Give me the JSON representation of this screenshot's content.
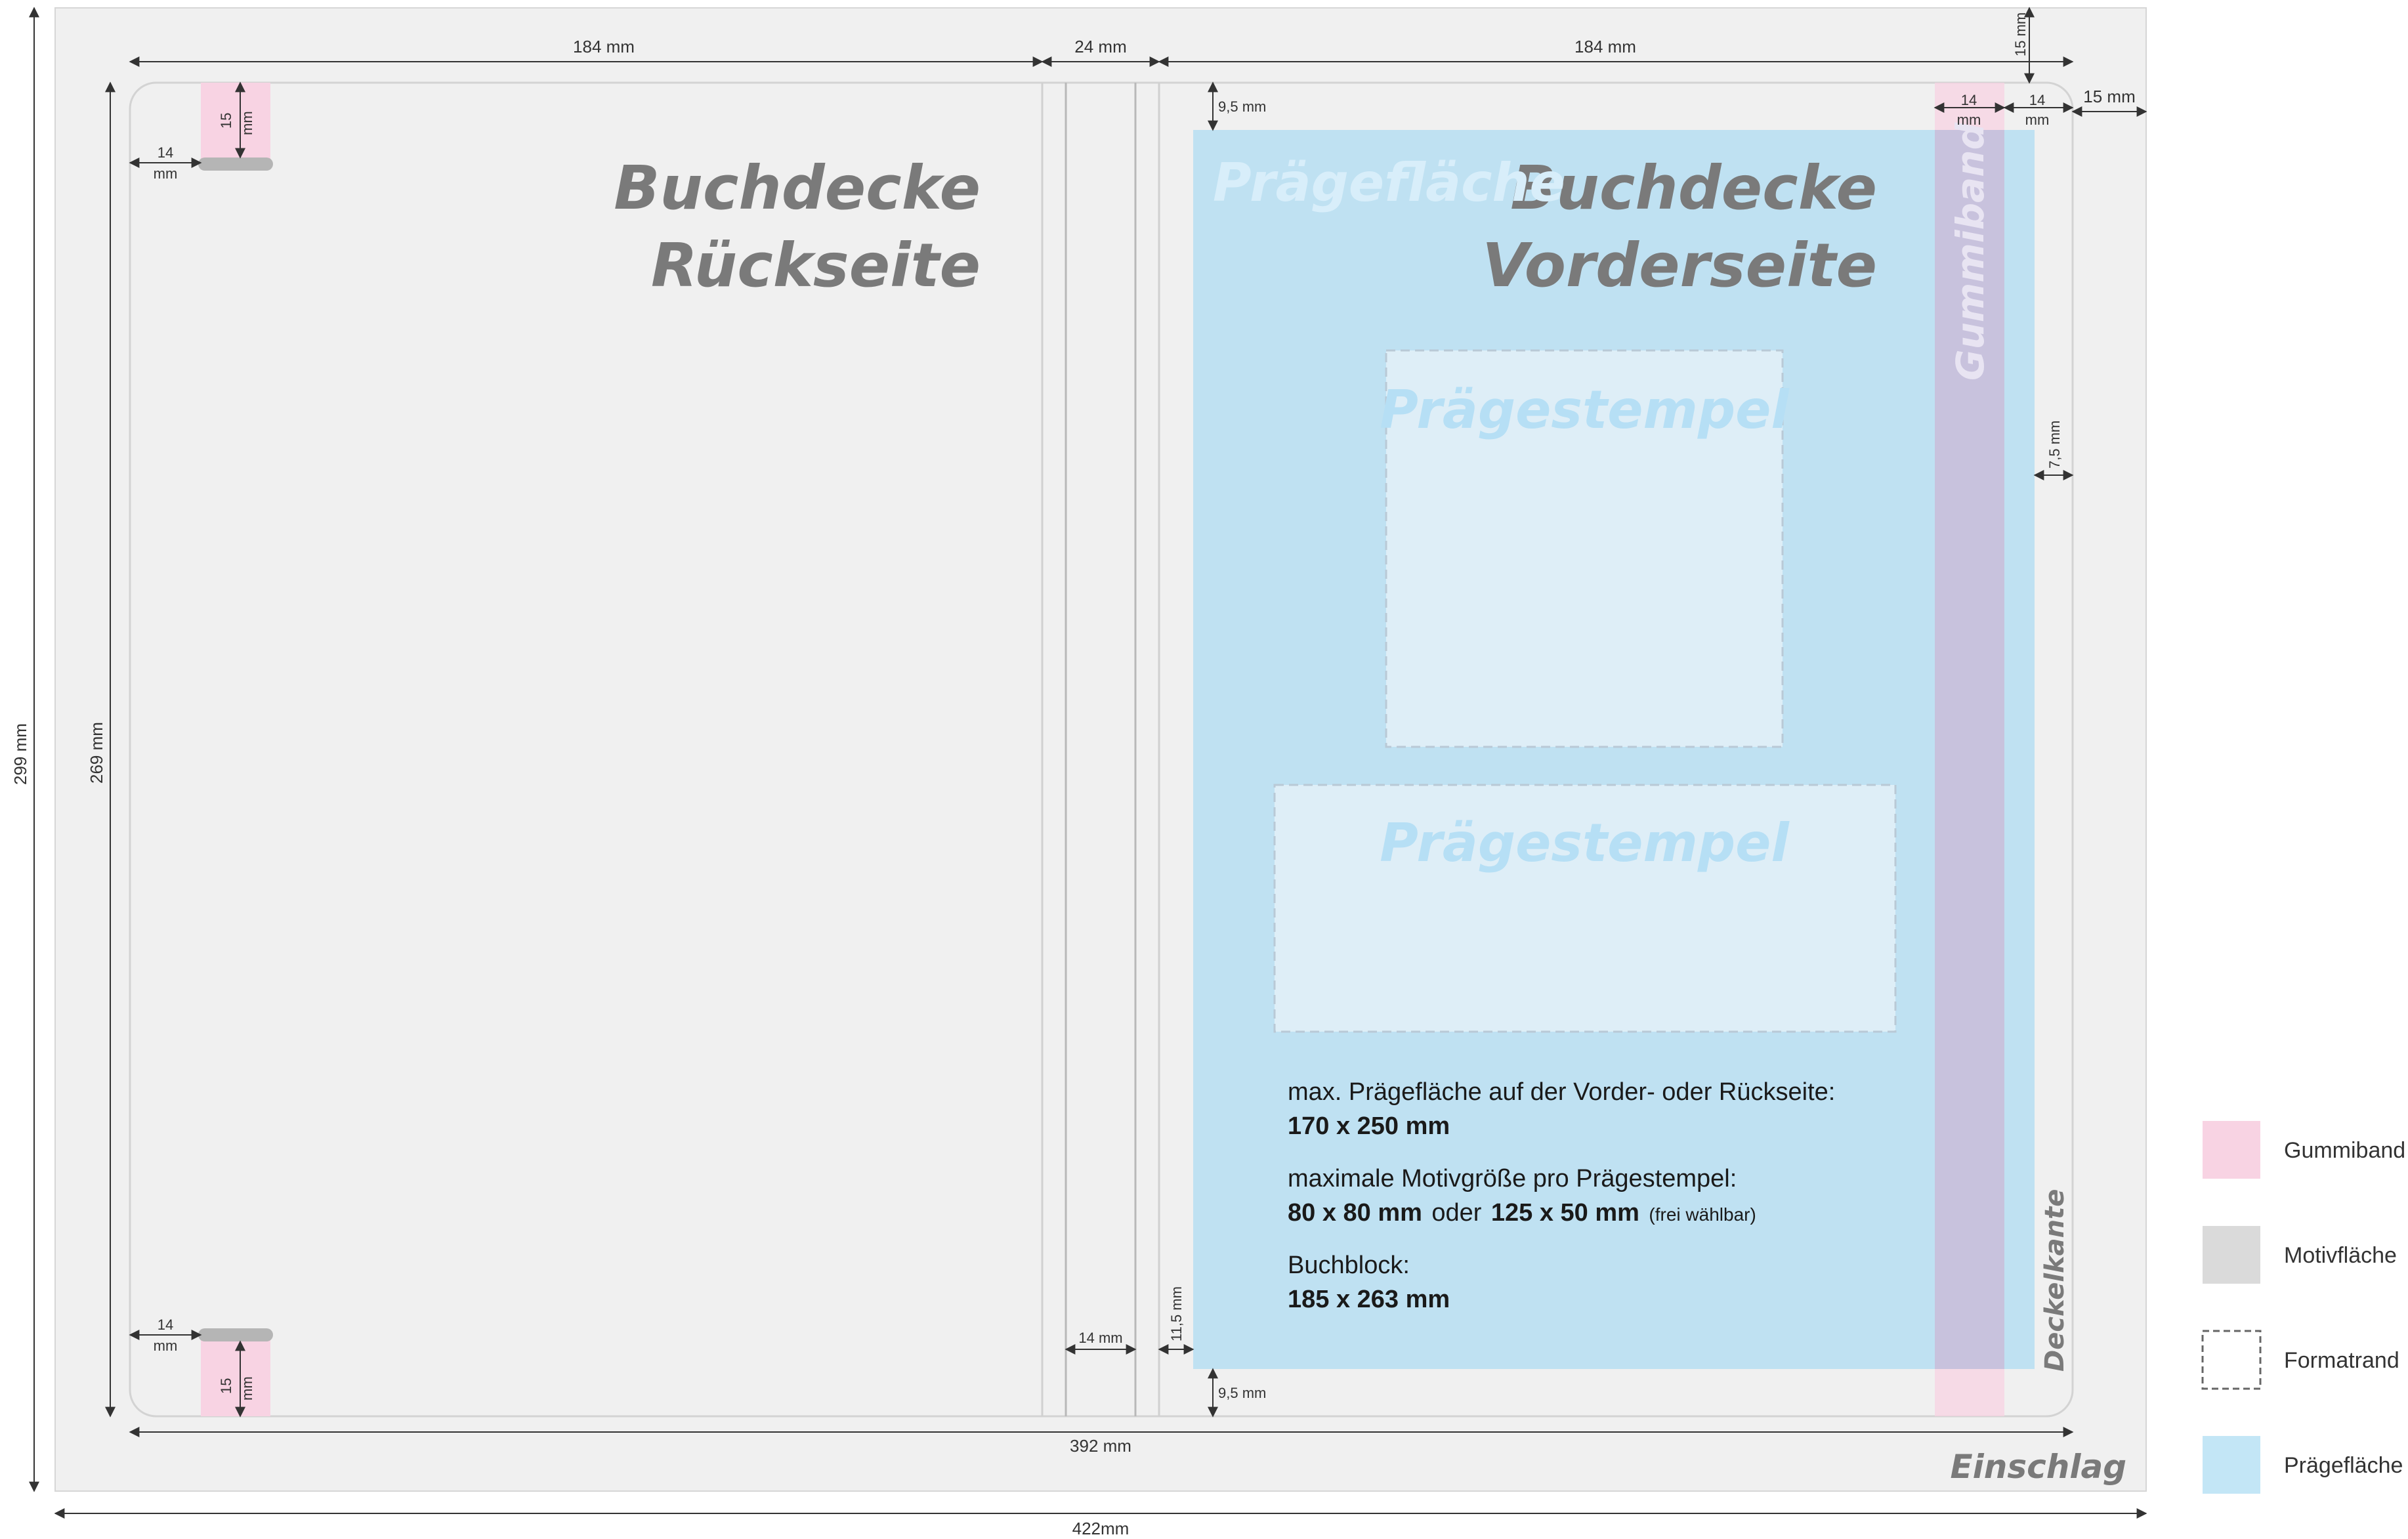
{
  "dimensions": {
    "cover_width_left": "184 mm",
    "spine_width": "24 mm",
    "cover_width_right": "184 mm",
    "top_margin": "15 mm",
    "right_margin": "15 mm",
    "rubber_band_offset": "14 mm",
    "rubber_band_offset_mm_line1": "14",
    "rubber_band_offset_mm_line2": "mm",
    "rubber_band_length_line1": "15",
    "rubber_band_length_line2": "mm",
    "embossing_top": "9,5 mm",
    "embossing_bottom": "9,5 mm",
    "embossing_side": "7,5 mm",
    "spine_inner": "14 mm",
    "spine_bottom": "11,5 mm",
    "inner_height": "269 mm",
    "total_height": "299 mm",
    "inner_width": "392 mm",
    "total_width": "422mm"
  },
  "labels": {
    "back_line1": "Buchdecke",
    "back_line2": "Rückseite",
    "front_line1": "Buchdecke",
    "front_line2": "Vorderseite",
    "embossing_area": "Prägefläche",
    "stamp1": "Prägestempel",
    "stamp2": "Prägestempel",
    "rubber_band": "Gummiband",
    "cover_edge": "Deckelkante",
    "turn_in": "Einschlag"
  },
  "info": {
    "line1": "max. Prägefläche auf der Vorder- oder Rückseite:",
    "line1_value": "170 x 250 mm",
    "line2": "maximale Motivgröße pro Prägestempel:",
    "line2_value_a": "80 x 80 mm",
    "line2_or": "oder",
    "line2_value_b": "125 x 50 mm",
    "line2_note": "(frei wählbar)",
    "line3": "Buchblock:",
    "line3_value": "185 x 263 mm"
  },
  "legend": [
    {
      "label": "Gummiband",
      "color": "#f8d3e3"
    },
    {
      "label": "Motivfläche",
      "color": "#dadada"
    },
    {
      "label": "Formatrand",
      "color": "#ffffff"
    },
    {
      "label": "Prägefläche",
      "color": "#c3e6f6"
    }
  ],
  "colors": {
    "background_outer": "#f0f0f0",
    "rubber_band": "#f8d3e3",
    "embossing": "#bfe1f2",
    "stamp": "#deeef7",
    "title_gray": "#7a7a7a",
    "light_text": "#d8eefa"
  }
}
